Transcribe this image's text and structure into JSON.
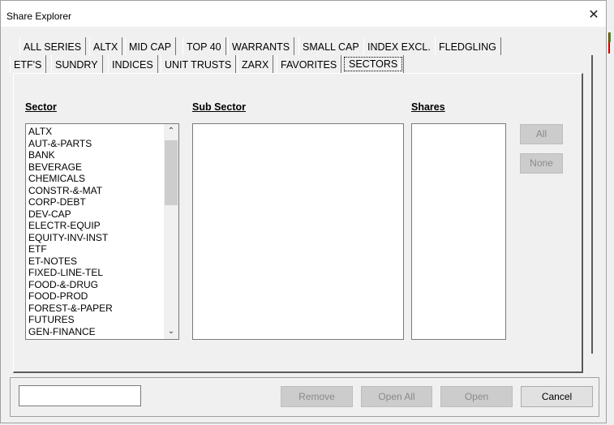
{
  "window": {
    "title": "Share Explorer",
    "close_glyph": "✕"
  },
  "tabs": {
    "row1": [
      "ALL SERIES",
      "ALTX",
      "MID CAP",
      "TOP 40",
      "WARRANTS",
      "SMALL CAP",
      "INDEX EXCL.",
      "FLEDGLING"
    ],
    "row2": [
      "ETF'S",
      "SUNDRY",
      "INDICES",
      "UNIT TRUSTS",
      "ZARX",
      "FAVORITES",
      "SECTORS"
    ],
    "selected": "SECTORS"
  },
  "columns": {
    "sector": "Sector",
    "sub_sector": "Sub Sector",
    "shares": "Shares"
  },
  "sectors": [
    "ALTX",
    "AUT-&-PARTS",
    "BANK",
    "BEVERAGE",
    "CHEMICALS",
    "CONSTR-&-MAT",
    "CORP-DEBT",
    "DEV-CAP",
    "ELECTR-EQUIP",
    "EQUITY-INV-INST",
    "ETF",
    "ET-NOTES",
    "FIXED-LINE-TEL",
    "FOOD-&-DRUG",
    "FOOD-PROD",
    "FOREST-&-PAPER",
    "FUTURES",
    "GEN-FINANCE"
  ],
  "sub_sectors": [],
  "shares": [],
  "side_buttons": {
    "all": "All",
    "none": "None"
  },
  "bottom": {
    "input_value": "",
    "remove": "Remove",
    "open_all": "Open All",
    "open": "Open",
    "cancel": "Cancel"
  },
  "icons": {
    "close": "close-icon",
    "scroll_up": "chevron-up-icon",
    "scroll_down": "chevron-down-icon"
  }
}
